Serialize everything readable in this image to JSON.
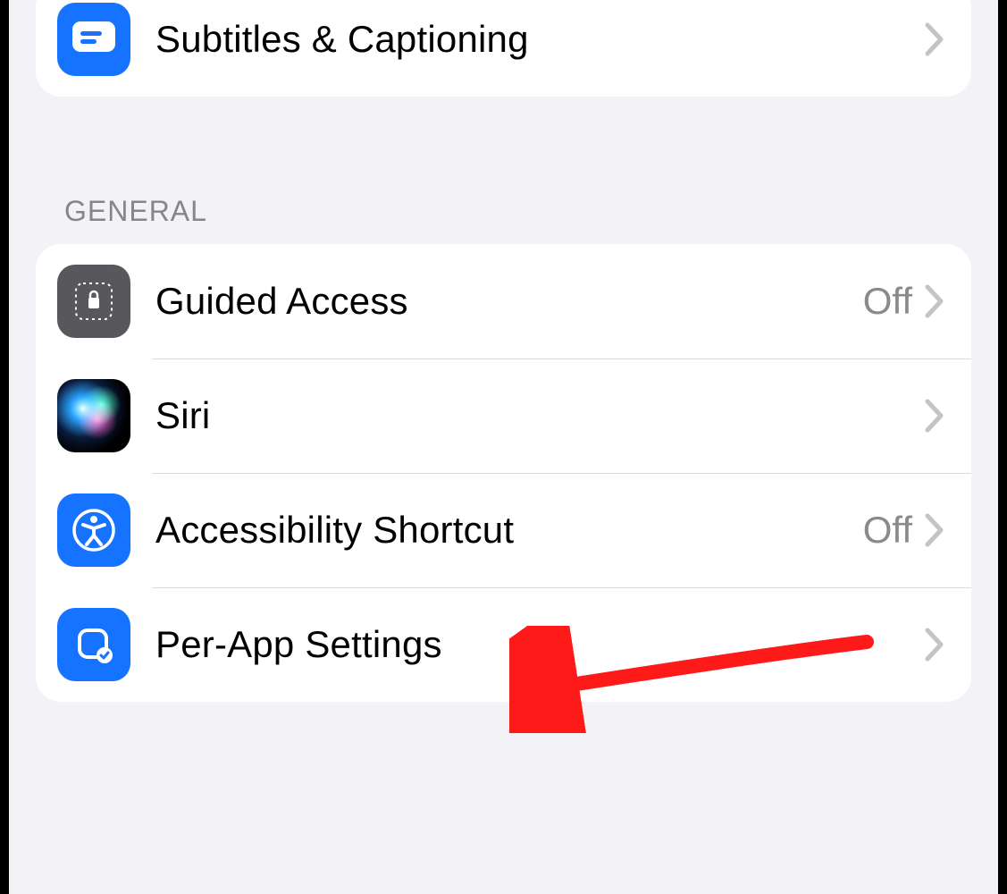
{
  "top_group": {
    "items": [
      {
        "label": "Subtitles & Captioning"
      }
    ]
  },
  "general": {
    "header": "GENERAL",
    "items": [
      {
        "label": "Guided Access",
        "value": "Off"
      },
      {
        "label": "Siri"
      },
      {
        "label": "Accessibility Shortcut",
        "value": "Off"
      },
      {
        "label": "Per-App Settings"
      }
    ]
  },
  "annotation": {
    "target": "Per-App Settings"
  },
  "colors": {
    "accent_blue": "#1673ff",
    "gray_icon": "#58585c",
    "chevron": "#c4c4c8",
    "value_gray": "#8a8a8e"
  }
}
